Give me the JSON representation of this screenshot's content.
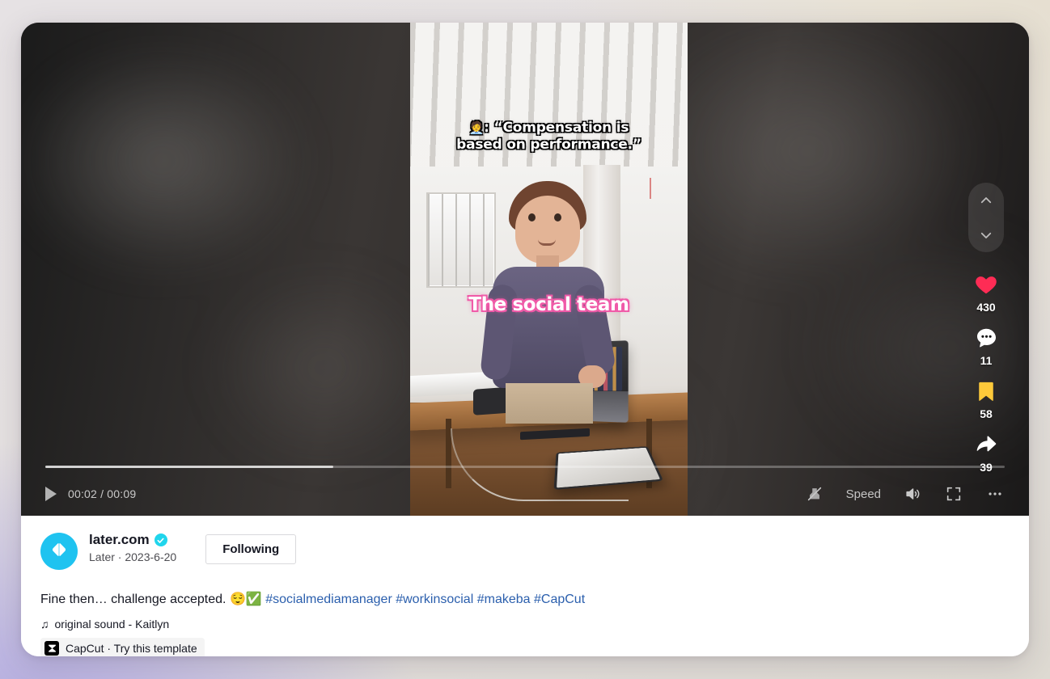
{
  "video": {
    "caption_emoji": "🧑‍💼",
    "caption_line1": ": “Compensation is",
    "caption_line2": "based on performance.”",
    "overlay_text": "The social team",
    "current_time": "00:02",
    "duration": "00:09",
    "time_display": "00:02 / 00:09",
    "progress_percent": 30,
    "speed_label": "Speed"
  },
  "rail": {
    "prev_icon": "chevron-up-icon",
    "next_icon": "chevron-down-icon",
    "actions": [
      {
        "icon": "heart-icon",
        "name": "like",
        "count": "430",
        "color": "#fe2c55"
      },
      {
        "icon": "comment-icon",
        "name": "comment",
        "count": "11",
        "color": "#ffffff"
      },
      {
        "icon": "bookmark-icon",
        "name": "favorite",
        "count": "58",
        "color": "#fdc93a"
      },
      {
        "icon": "share-arrow-icon",
        "name": "share",
        "count": "39",
        "color": "#ffffff"
      }
    ]
  },
  "controls": {
    "play_icon": "play-icon",
    "clear_mode_icon": "clear-mode-off-icon",
    "volume_icon": "volume-on-icon",
    "fullscreen_icon": "fullscreen-icon",
    "more_icon": "more-options-icon"
  },
  "author": {
    "avatar_icon": "later-logo-icon",
    "name": "later.com",
    "verified_icon": "verified-badge-icon",
    "subtitle": "Later · 2023-6-20",
    "follow_label": "Following"
  },
  "post": {
    "description_text": "Fine then… challenge accepted. ",
    "emoji1": "😌",
    "emoji2": "✅",
    "hashtags": [
      "#socialmediamanager",
      "#workinsocial",
      "#makeba",
      "#CapCut"
    ],
    "sound_icon": "music-note-icon",
    "sound_label": "original sound - Kaitlyn",
    "capcut_icon": "capcut-logo-icon",
    "capcut_label": "CapCut · Try this template"
  },
  "colors": {
    "accent_cyan": "#20d5ec",
    "like_red": "#fe2c55",
    "bookmark_yellow": "#fdc93a",
    "link_blue": "#2b5fad"
  }
}
